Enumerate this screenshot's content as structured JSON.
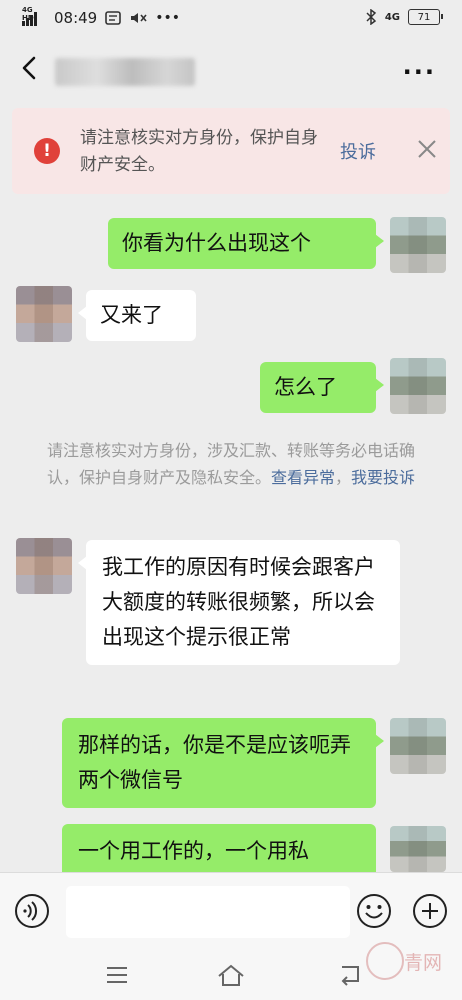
{
  "status_bar": {
    "network": "4G HD",
    "time": "08:49",
    "right_network": "4G",
    "battery": "71"
  },
  "header": {
    "contact_name_blurred": true
  },
  "banner": {
    "text": "请注意核实对方身份，保护自身财产安全。",
    "report": "投诉"
  },
  "messages": [
    {
      "from": "self",
      "text": "你看为什么出现这个"
    },
    {
      "from": "other",
      "text": "又来了"
    },
    {
      "from": "self",
      "text": "怎么了"
    },
    {
      "from": "other",
      "text": "我工作的原因有时候会跟客户大额度的转账很频繁，所以会出现这个提示很正常"
    },
    {
      "from": "self",
      "text": "那样的话，你是不是应该呃弄两个微信号"
    },
    {
      "from": "self",
      "text": "一个用工作的，一个用私"
    }
  ],
  "system_notice": {
    "text": "请注意核实对方身份，涉及汇款、转账等务必电话确认，保护自身财产及隐私安全。",
    "link_view": "查看异常",
    "separator": "，",
    "link_report": "我要投诉"
  },
  "input_bar": {
    "placeholder": ""
  },
  "watermark": {
    "text": "青网"
  },
  "colors": {
    "self_bubble": "#95ec69",
    "other_bubble": "#ffffff",
    "background": "#ededed",
    "warning": "#e0413a",
    "link": "#4b6c9c"
  }
}
